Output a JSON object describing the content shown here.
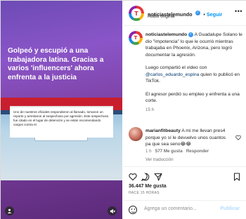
{
  "media": {
    "headline": "Golpeó y escupió a una trabajadora latina. Gracias a varios 'influencers' ahora enfrenta a la justicia",
    "quote_text": "Uno de nuestros oficiales respondieron al llamado, tomaron un reporte y arrestaron al sospechoso por agresión. Este sospechoso fue citado en el lugar de detención y se están recomendando cargos contra el.",
    "mute_icon": "mute-icon",
    "user_icon": "user-tag-icon"
  },
  "header": {
    "username": "noticiastelemundo",
    "follow_label": "Seguir",
    "subtitle": "Audio original",
    "more_label": "•••"
  },
  "caption": {
    "username": "noticiastelemundo",
    "text_1": "A Guadalupe Solano le dio \"impotencia\" lo que le ocurrió mientras trabajaba en Phoenix, Arizona, pero logró documentar la agresión.",
    "text_2_prefix": "Luego compartió el video con",
    "mention": "@carlos_eduardo_espina",
    "text_2_suffix": "quien lo publicó en TikTok.",
    "text_3": "El agresor perdió su empleo y enfrenta a una corte.",
    "time": "15 h",
    "translate": "Ver traducción"
  },
  "comment": {
    "username": "marianfitbeauty",
    "text": "A mi me llevan pres4 porque yo sí le devuelvo unos cuantos pa que sea seno😂😂",
    "time": "1 h",
    "likes": "577 Me gusta",
    "reply": "Responder",
    "translate": "Ver traducción"
  },
  "actions": {
    "likes": "36.447 Me gusta",
    "date": "HACE 15 HORAS"
  },
  "add_comment": {
    "placeholder": "Agrega un comentario...",
    "post_label": "Publicar"
  }
}
